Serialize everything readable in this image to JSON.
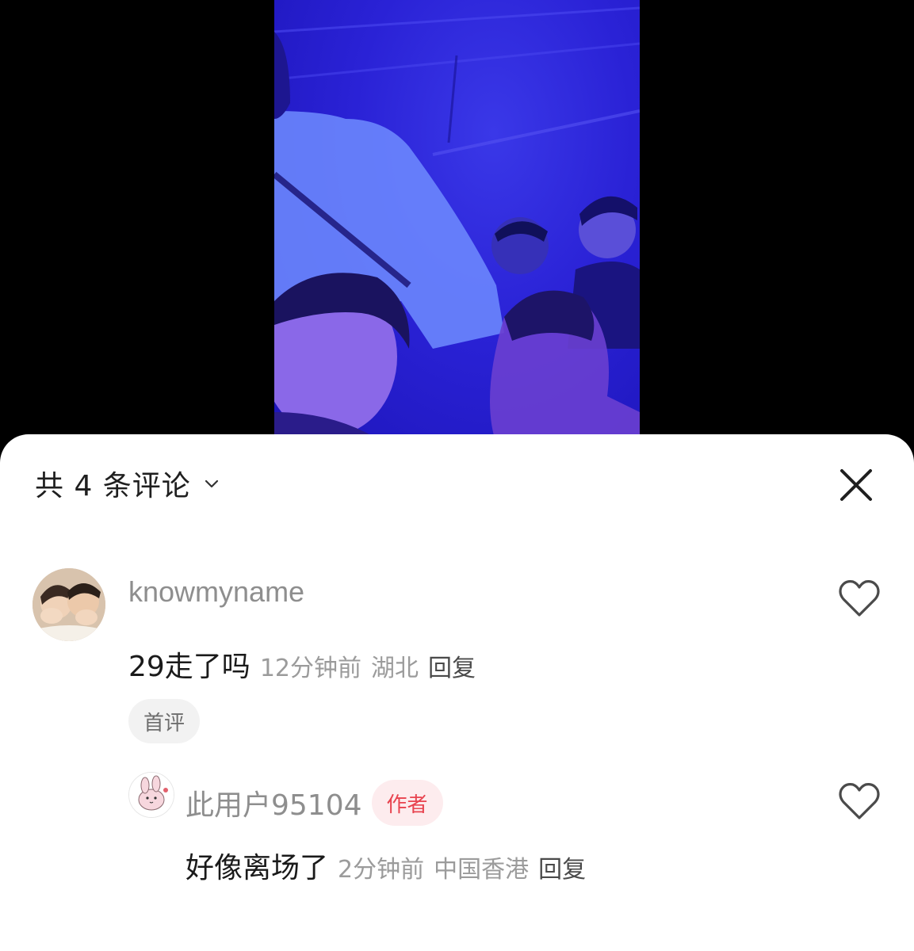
{
  "sheet": {
    "title": "共 4 条评论",
    "chevron_icon": "chevron-down-icon",
    "close_icon": "close-icon"
  },
  "comments": [
    {
      "username": "knowmyname",
      "text": "29走了吗",
      "time": "12分钟前",
      "location": "湖北",
      "reply_label": "回复",
      "badge": "首评",
      "like_icon": "heart-outline-icon",
      "replies": [
        {
          "username": "此用户95104",
          "author_badge": "作者",
          "text": "好像离场了",
          "time": "2分钟前",
          "location": "中国香港",
          "reply_label": "回复",
          "like_icon": "heart-outline-icon"
        }
      ]
    }
  ],
  "colors": {
    "video_tint": "#2a22d6",
    "author_badge_bg": "#fdecee",
    "author_badge_text": "#e8434f",
    "meta_text": "#9b9b9b"
  }
}
